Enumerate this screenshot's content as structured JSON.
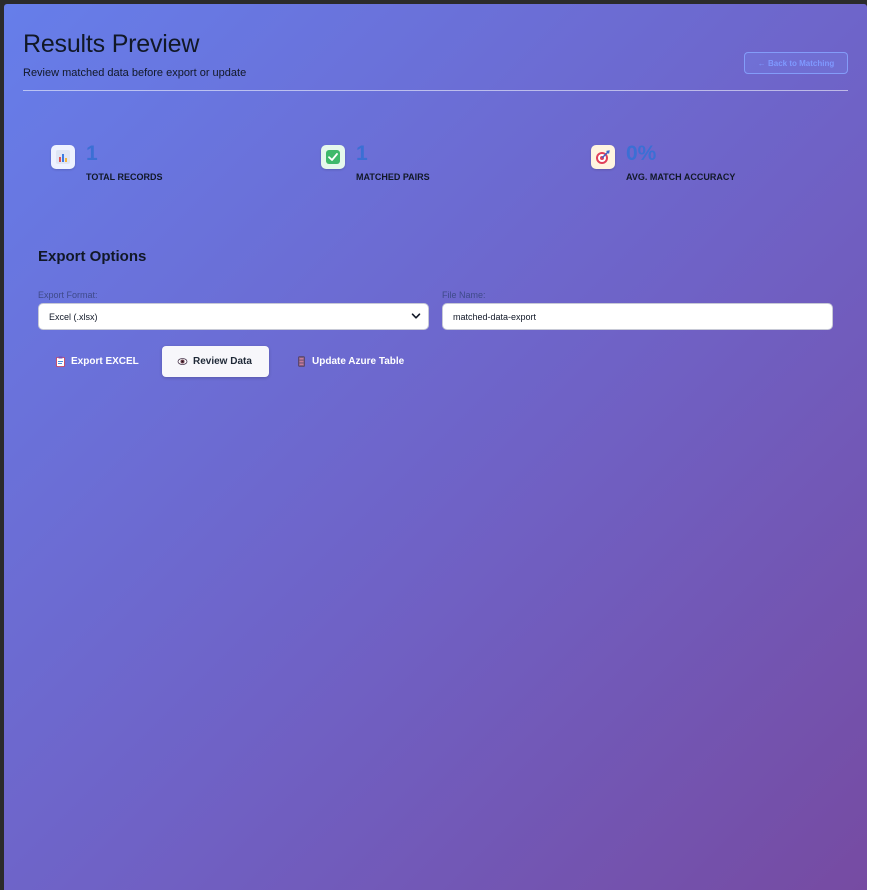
{
  "header": {
    "title": "Results Preview",
    "subtitle": "Review matched data before export or update",
    "back_button": "← Back to Matching"
  },
  "stats": [
    {
      "icon": "bar-chart-icon",
      "value": "1",
      "label": "TOTAL RECORDS"
    },
    {
      "icon": "check-box-icon",
      "value": "1",
      "label": "MATCHED PAIRS"
    },
    {
      "icon": "target-icon",
      "value": "0%",
      "label": "AVG. MATCH ACCURACY"
    }
  ],
  "export": {
    "title": "Export Options",
    "format_label": "Export Format:",
    "format_value": "Excel (.xlsx)",
    "filename_label": "File Name:",
    "filename_value": "matched-data-export"
  },
  "actions": {
    "export_label": "Export EXCEL",
    "review_label": "Review Data",
    "update_label": "Update Azure Table"
  },
  "colors": {
    "gradient_start": "#667eea",
    "gradient_end": "#764ba2",
    "stat_value": "#3b6fd4"
  }
}
